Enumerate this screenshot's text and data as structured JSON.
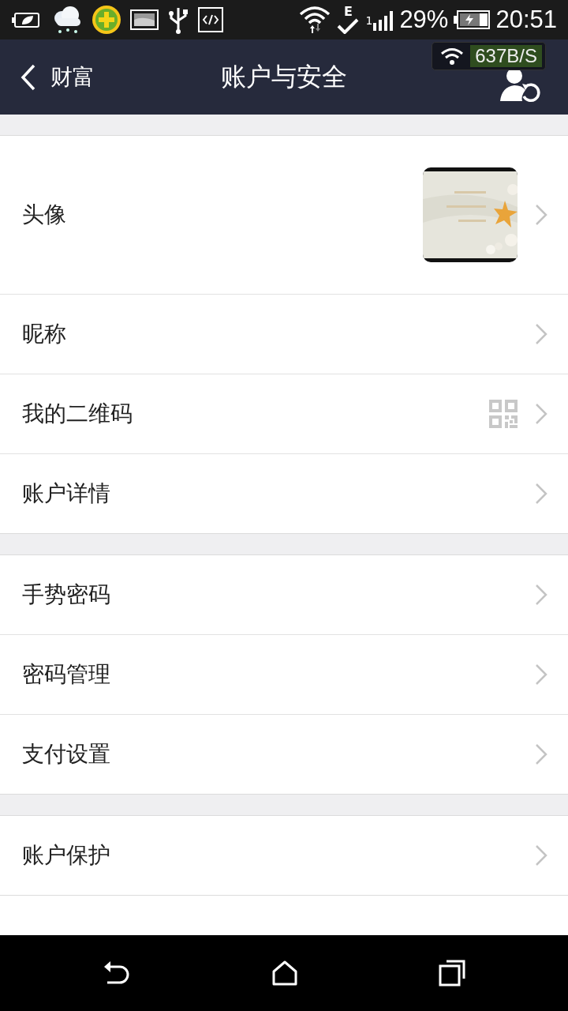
{
  "status_bar": {
    "network_type": "E",
    "signal_label": "1",
    "battery": "29%",
    "time": "20:51"
  },
  "speed_overlay": {
    "speed": "637B/S"
  },
  "header": {
    "back_label": "财富",
    "title": "账户与安全"
  },
  "groups": [
    {
      "items": [
        {
          "label": "头像",
          "kind": "avatar"
        },
        {
          "label": "昵称",
          "kind": "plain"
        },
        {
          "label": "我的二维码",
          "kind": "qr"
        },
        {
          "label": "账户详情",
          "kind": "plain"
        }
      ]
    },
    {
      "items": [
        {
          "label": "手势密码",
          "kind": "plain"
        },
        {
          "label": "密码管理",
          "kind": "plain"
        },
        {
          "label": "支付设置",
          "kind": "plain"
        }
      ]
    },
    {
      "items": [
        {
          "label": "账户保护",
          "kind": "plain"
        }
      ]
    }
  ]
}
